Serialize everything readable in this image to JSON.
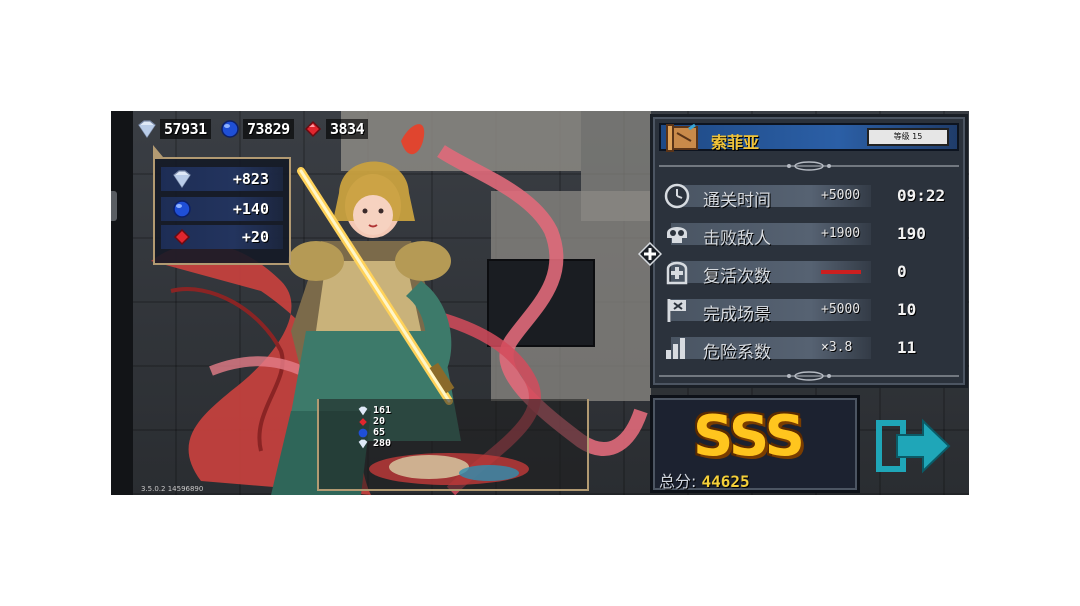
{
  "currency": {
    "diamonds": "57931",
    "sapphires": "73829",
    "rubies": "3834"
  },
  "gains": [
    {
      "icon": "diamond-icon",
      "value": "+823"
    },
    {
      "icon": "sapphire-icon",
      "value": "+140"
    },
    {
      "icon": "ruby-icon",
      "value": "+20"
    }
  ],
  "loot": [
    {
      "icon": "diamond-icon",
      "value": "161"
    },
    {
      "icon": "ruby-icon",
      "value": "20"
    },
    {
      "icon": "sapphire-icon",
      "value": "65"
    },
    {
      "icon": "diamond-icon",
      "value": "280"
    }
  ],
  "version": "3.5.0.2 14596890",
  "hero": {
    "name": "索菲亚",
    "level": "等级 15"
  },
  "stats": [
    {
      "icon": "clock-icon",
      "label": "通关时间",
      "bonus": "+5000",
      "value": "09:22"
    },
    {
      "icon": "skull-icon",
      "label": "击败敌人",
      "bonus": "+1900",
      "value": "190"
    },
    {
      "icon": "revive-icon",
      "label": "复活次数",
      "bonus": "",
      "value": "0"
    },
    {
      "icon": "flag-icon",
      "label": "完成场景",
      "bonus": "+5000",
      "value": "10"
    },
    {
      "icon": "danger-bars-icon",
      "label": "危险系数",
      "bonus": "×3.8",
      "value": "11"
    }
  ],
  "score": {
    "grade": "SSS",
    "total_label": "总分:",
    "total_value": "44625"
  },
  "colors": {
    "gold": "#f0c43a",
    "panel": "#2b323c",
    "name_bar": "#2b5fa6",
    "next_arrow": "#1fa6b8"
  }
}
